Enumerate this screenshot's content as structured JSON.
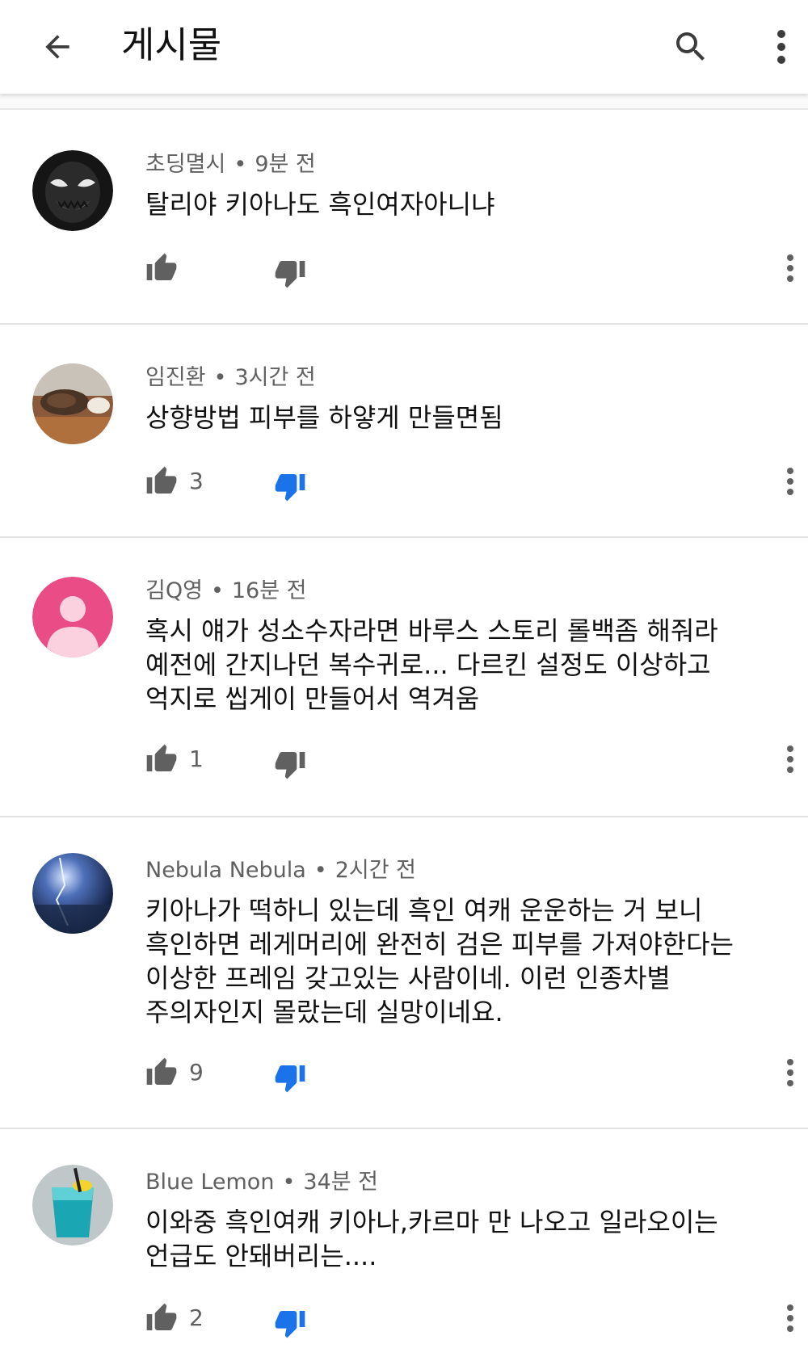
{
  "appbar": {
    "title": "게시물",
    "back_icon": "arrow-back-icon",
    "search_icon": "search-icon",
    "more_icon": "more-vert-icon"
  },
  "colors": {
    "accent_blue": "#1a73e8",
    "icon_gray": "#606060",
    "text": "#111111"
  },
  "comments": [
    {
      "author": "초딩멸시",
      "time": "9분 전",
      "lines": [
        "탈리야 키아나도 흑인여자아니냐"
      ],
      "likes": "",
      "disliked": false
    },
    {
      "author": "임진환",
      "time": "3시간 전",
      "lines": [
        "상향방법 피부를 하얗게 만들면됨"
      ],
      "likes": "3",
      "disliked": true
    },
    {
      "author": "김Q영",
      "time": "16분 전",
      "lines": [
        "혹시 얘가 성소수자라면 바루스 스토리 롤백좀 해줘라",
        "예전에 간지나던 복수귀로... 다르킨 설정도 이상하고",
        "억지로 씹게이 만들어서 역겨움"
      ],
      "likes": "1",
      "disliked": false
    },
    {
      "author": "Nebula Nebula",
      "time": "2시간 전",
      "lines": [
        "키아나가 떡하니 있는데 흑인 여캐 운운하는 거 보니",
        "흑인하면 레게머리에 완전히 검은 피부를 가져야한다는",
        "이상한 프레임 갖고있는 사람이네. 이런 인종차별",
        "주의자인지 몰랐는데 실망이네요."
      ],
      "likes": "9",
      "disliked": true
    },
    {
      "author": "Blue Lemon",
      "time": "34분 전",
      "lines": [
        "이와중 흑인여캐 키아나,카르마 만 나오고 일라오이는",
        "언급도 안돼버리는...."
      ],
      "likes": "2",
      "disliked": true
    }
  ]
}
